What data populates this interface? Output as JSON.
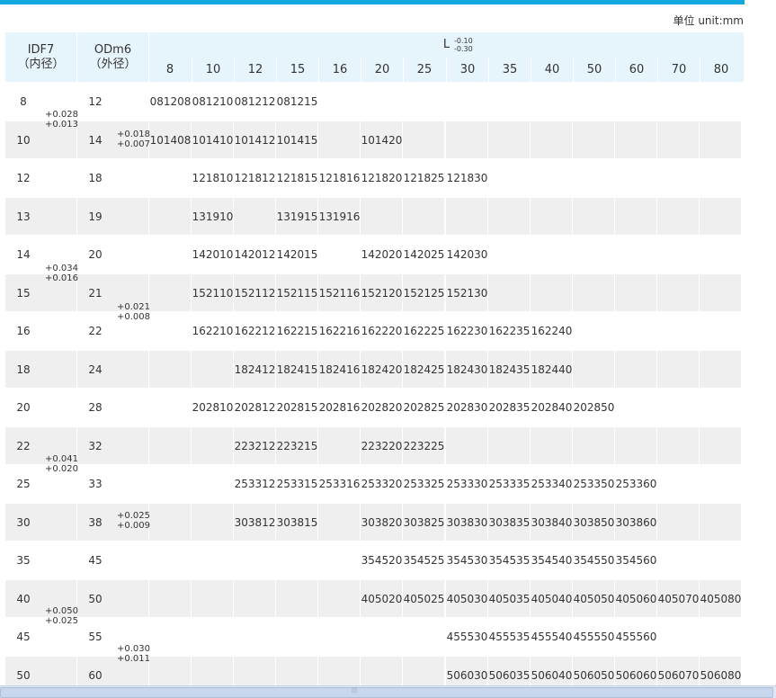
{
  "unit_label": "单位 unit:mm",
  "headers": {
    "id_title": "IDF7",
    "id_sub": "（内径）",
    "od_title": "ODm6",
    "od_sub": "（外径）",
    "l_title": "L",
    "l_tol_upper": "-0.10",
    "l_tol_lower": "-0.30",
    "l_columns": [
      "8",
      "10",
      "12",
      "15",
      "16",
      "20",
      "25",
      "30",
      "35",
      "40",
      "50",
      "60",
      "70",
      "80"
    ]
  },
  "rows": [
    {
      "id": "8",
      "od": "12",
      "cells": [
        "081208",
        "081210",
        "081212",
        "081215",
        "",
        "",
        "",
        "",
        "",
        "",
        "",
        "",
        "",
        ""
      ]
    },
    {
      "id": "10",
      "od": "14",
      "cells": [
        "101408",
        "101410",
        "101412",
        "101415",
        "",
        "101420",
        "",
        "",
        "",
        "",
        "",
        "",
        "",
        ""
      ]
    },
    {
      "id": "12",
      "od": "18",
      "cells": [
        "",
        "121810",
        "121812",
        "121815",
        "121816",
        "121820",
        "121825",
        "121830",
        "",
        "",
        "",
        "",
        "",
        ""
      ]
    },
    {
      "id": "13",
      "od": "19",
      "cells": [
        "",
        "131910",
        "",
        "131915",
        "131916",
        "",
        "",
        "",
        "",
        "",
        "",
        "",
        "",
        ""
      ]
    },
    {
      "id": "14",
      "od": "20",
      "cells": [
        "",
        "142010",
        "142012",
        "142015",
        "",
        "142020",
        "142025",
        "142030",
        "",
        "",
        "",
        "",
        "",
        ""
      ]
    },
    {
      "id": "15",
      "od": "21",
      "cells": [
        "",
        "152110",
        "152112",
        "152115",
        "152116",
        "152120",
        "152125",
        "152130",
        "",
        "",
        "",
        "",
        "",
        ""
      ]
    },
    {
      "id": "16",
      "od": "22",
      "cells": [
        "",
        "162210",
        "162212",
        "162215",
        "162216",
        "162220",
        "162225",
        "162230",
        "162235",
        "162240",
        "",
        "",
        "",
        ""
      ]
    },
    {
      "id": "18",
      "od": "24",
      "cells": [
        "",
        "",
        "182412",
        "182415",
        "182416",
        "182420",
        "182425",
        "182430",
        "182435",
        "182440",
        "",
        "",
        "",
        ""
      ]
    },
    {
      "id": "20",
      "od": "28",
      "cells": [
        "",
        "202810",
        "202812",
        "202815",
        "202816",
        "202820",
        "202825",
        "202830",
        "202835",
        "202840",
        "202850",
        "",
        "",
        ""
      ]
    },
    {
      "id": "22",
      "od": "32",
      "cells": [
        "",
        "",
        "223212",
        "223215",
        "",
        "223220",
        "223225",
        "",
        "",
        "",
        "",
        "",
        "",
        ""
      ]
    },
    {
      "id": "25",
      "od": "33",
      "cells": [
        "",
        "",
        "253312",
        "253315",
        "253316",
        "253320",
        "253325",
        "253330",
        "253335",
        "253340",
        "253350",
        "253360",
        "",
        ""
      ]
    },
    {
      "id": "30",
      "od": "38",
      "cells": [
        "",
        "",
        "303812",
        "303815",
        "",
        "303820",
        "303825",
        "303830",
        "303835",
        "303840",
        "303850",
        "303860",
        "",
        ""
      ]
    },
    {
      "id": "35",
      "od": "45",
      "cells": [
        "",
        "",
        "",
        "",
        "",
        "354520",
        "354525",
        "354530",
        "354535",
        "354540",
        "354550",
        "354560",
        "",
        ""
      ]
    },
    {
      "id": "40",
      "od": "50",
      "cells": [
        "",
        "",
        "",
        "",
        "",
        "405020",
        "405025",
        "405030",
        "405035",
        "405040",
        "405050",
        "405060",
        "405070",
        "405080"
      ]
    },
    {
      "id": "45",
      "od": "55",
      "cells": [
        "",
        "",
        "",
        "",
        "",
        "",
        "",
        "455530",
        "455535",
        "455540",
        "455550",
        "455560",
        "",
        ""
      ]
    },
    {
      "id": "50",
      "od": "60",
      "cells": [
        "",
        "",
        "",
        "",
        "",
        "",
        "",
        "506030",
        "506035",
        "506040",
        "506050",
        "506060",
        "506070",
        "506080"
      ]
    }
  ],
  "id_tolerances": [
    {
      "upper": "+0.028",
      "lower": "+0.013"
    },
    {
      "upper": "+0.034",
      "lower": "+0.016"
    },
    {
      "upper": "+0.041",
      "lower": "+0.020"
    },
    {
      "upper": "+0.050",
      "lower": "+0.025"
    }
  ],
  "od_tolerances": [
    {
      "upper": "+0.018",
      "lower": "+0.007"
    },
    {
      "upper": "+0.021",
      "lower": "+0.008"
    },
    {
      "upper": "+0.025",
      "lower": "+0.009"
    },
    {
      "upper": "+0.030",
      "lower": "+0.011"
    }
  ]
}
